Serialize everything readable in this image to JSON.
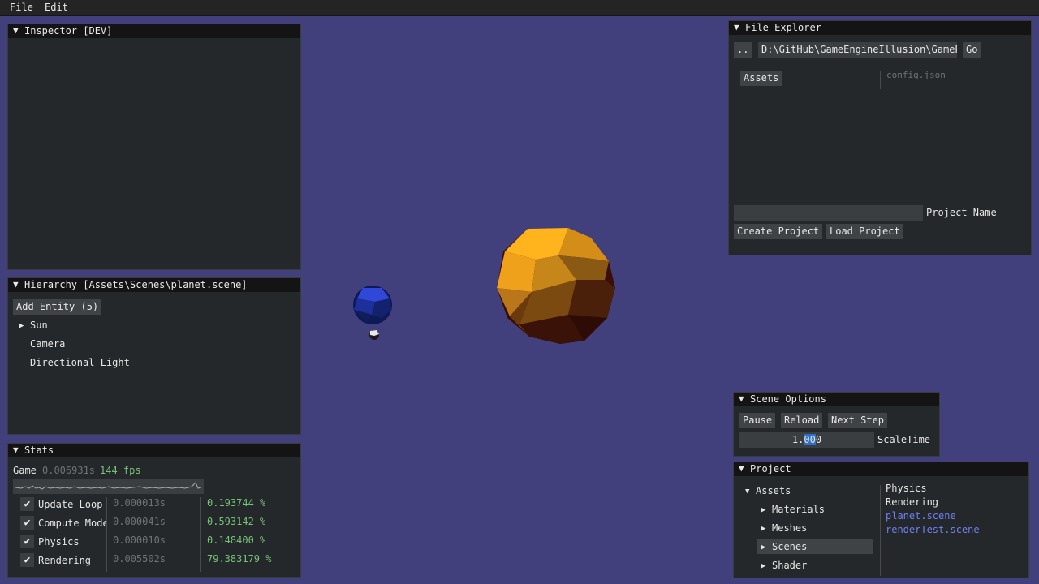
{
  "menubar": {
    "items": [
      "File",
      "Edit"
    ]
  },
  "inspector": {
    "title": "Inspector [DEV]"
  },
  "hierarchy": {
    "title": "Hierarchy [Assets\\Scenes\\planet.scene]",
    "add_entity": "Add Entity (5)",
    "entities": [
      "Sun",
      "Camera",
      "Directional Light"
    ]
  },
  "stats": {
    "title": "Stats",
    "game_label": "Game",
    "game_time": "0.006931s",
    "game_fps": "144 fps",
    "rows": [
      {
        "name": "Update Loop",
        "time": "0.000013s",
        "percent": "0.193744 %",
        "checked": true
      },
      {
        "name": "Compute Mode",
        "time": "0.000041s",
        "percent": "0.593142 %",
        "checked": true
      },
      {
        "name": "Physics",
        "time": "0.000010s",
        "percent": "0.148400 %",
        "checked": true
      },
      {
        "name": "Rendering",
        "time": "0.005502s",
        "percent": "79.383179 %",
        "checked": true
      }
    ]
  },
  "file_explorer": {
    "title": "File Explorer",
    "up_button": "..",
    "path": "D:\\GitHub\\GameEngineIllusion\\GamePr",
    "go_button": "Go",
    "folder": "Assets",
    "file": "config.json",
    "project_name_label": "Project Name",
    "project_name_value": "",
    "create_button": "Create Project",
    "load_button": "Load Project"
  },
  "scene_options": {
    "title": "Scene Options",
    "pause": "Pause",
    "reload": "Reload",
    "next_step": "Next Step",
    "scale_value_a": "1.",
    "scale_value_b": "00",
    "scale_value_c": "0",
    "scale_label": "ScaleTime"
  },
  "project": {
    "title": "Project",
    "root": "Assets",
    "folders": [
      "Materials",
      "Meshes",
      "Scenes",
      "Shader"
    ],
    "selected_folder": "Scenes",
    "files": [
      {
        "name": "Physics",
        "kind": "folder"
      },
      {
        "name": "Rendering",
        "kind": "folder"
      },
      {
        "name": "planet.scene",
        "kind": "scene"
      },
      {
        "name": "renderTest.scene",
        "kind": "scene"
      }
    ]
  },
  "colors": {
    "viewport_bg": "#423f7d",
    "panel_bg": "#24282a",
    "titlebar_bg": "#141414",
    "sun": "#f2a81c",
    "planet": "#2b3fbf",
    "green_text": "#74c274",
    "scene_link": "#6f7ff0"
  }
}
